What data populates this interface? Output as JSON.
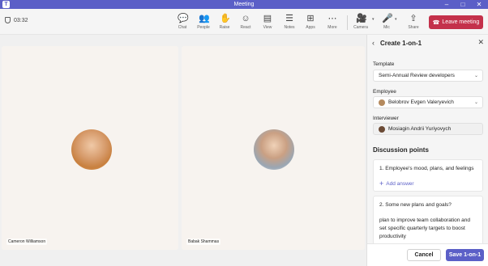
{
  "window": {
    "title": "Meeting",
    "app_logo": "T"
  },
  "toolbar": {
    "timer": "03:32",
    "buttons": [
      {
        "icon": "chat-icon",
        "label": "Chat"
      },
      {
        "icon": "people-icon",
        "label": "People"
      },
      {
        "icon": "raise-hand-icon",
        "label": "Raise"
      },
      {
        "icon": "react-icon",
        "label": "React"
      },
      {
        "icon": "view-icon",
        "label": "View"
      },
      {
        "icon": "notes-icon",
        "label": "Notes"
      },
      {
        "icon": "apps-icon",
        "label": "Apps"
      },
      {
        "icon": "more-icon",
        "label": "More"
      },
      {
        "icon": "camera-icon",
        "label": "Camera"
      },
      {
        "icon": "mic-icon",
        "label": "Mic"
      },
      {
        "icon": "share-icon",
        "label": "Share"
      }
    ],
    "leave_label": "Leave meeting"
  },
  "participants": [
    {
      "name": "Cameron Williamson"
    },
    {
      "name": "Babak Shammas"
    }
  ],
  "panel": {
    "title": "Create 1-on-1",
    "template_label": "Template",
    "template_value": "Semi-Annual Review developers",
    "employee_label": "Employee",
    "employee_value": "Belobrov Evgen Valeryevich",
    "interviewer_label": "Interviewer",
    "interviewer_value": "Mosiagin Andrii Yuriyovych",
    "discussion_title": "Discussion points",
    "points": [
      {
        "question": "1.  Employee's mood, plans, and feelings",
        "action": "Add answer"
      },
      {
        "question": "2.  Some new plans and goals?",
        "answer": "plan to improve team collaboration and set specific quarterly targets to boost productivity"
      }
    ],
    "cancel_label": "Cancel",
    "save_label": "Save 1-on-1"
  },
  "colors": {
    "brand": "#5b5fc7",
    "leave": "#c4314b"
  }
}
